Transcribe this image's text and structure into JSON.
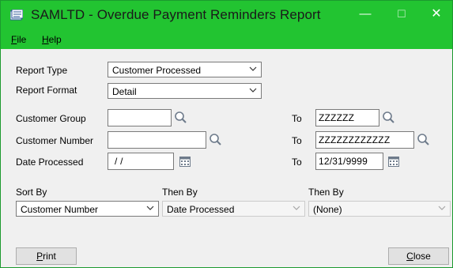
{
  "window": {
    "title": "SAMLTD - Overdue Payment Reminders Report",
    "controls": {
      "minimize": "—",
      "maximize": "☐",
      "close": "✕"
    },
    "colors": {
      "titlebar": "#22c431",
      "panel": "#f0f0f0"
    }
  },
  "menu": {
    "items": [
      {
        "accel": "F",
        "rest": "ile"
      },
      {
        "accel": "H",
        "rest": "elp"
      }
    ]
  },
  "form": {
    "report_type": {
      "label": "Report Type",
      "value": "Customer Processed"
    },
    "report_format": {
      "label": "Report Format",
      "value": "Detail"
    },
    "customer_group": {
      "label": "Customer Group",
      "from": "",
      "to_label": "To",
      "to": "ZZZZZZ"
    },
    "customer_number": {
      "label": "Customer Number",
      "from": "",
      "to_label": "To",
      "to": "ZZZZZZZZZZZZ"
    },
    "date_processed": {
      "label": "Date Processed",
      "from": "/ /",
      "to_label": "To",
      "to": "12/31/9999"
    },
    "sort": [
      {
        "label": "Sort By",
        "value": "Customer Number",
        "enabled": true
      },
      {
        "label": "Then By",
        "value": "Date Processed",
        "enabled": false
      },
      {
        "label": "Then By",
        "value": "(None)",
        "enabled": false
      }
    ]
  },
  "buttons": {
    "print": {
      "accel": "P",
      "rest": "rint"
    },
    "close": {
      "accel": "C",
      "rest": "lose"
    }
  }
}
